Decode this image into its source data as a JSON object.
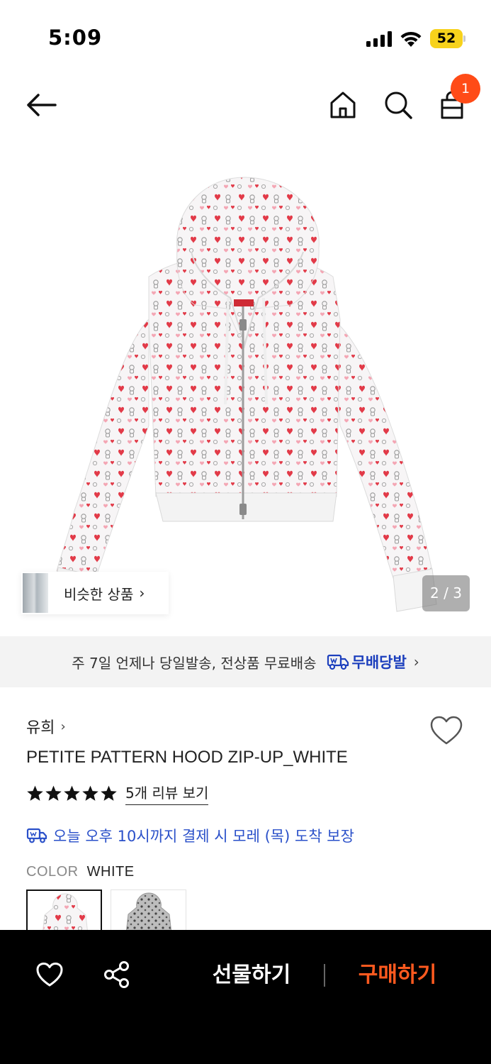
{
  "status_bar": {
    "time": "5:09",
    "battery": "52",
    "battery_color": "#f7d21c",
    "icons": [
      "signal-icon",
      "wifi-icon",
      "battery-icon"
    ]
  },
  "nav": {
    "icons": [
      "back-arrow-icon",
      "home-icon",
      "search-icon",
      "shopping-bag-icon"
    ],
    "cart_count": "1",
    "badge_color": "#ff4b17"
  },
  "gallery": {
    "similar_label": "비슷한 상품",
    "similar_chevron": "›",
    "counter": "2 / 3"
  },
  "shipping_banner": {
    "text": "주 7일 언제나 당일발송, 전상품 무료배송",
    "brand": "무배당발",
    "chevron": "›",
    "brand_color": "#1c3fbd"
  },
  "product": {
    "brand": "유희",
    "brand_chevron": "›",
    "title": "PETITE PATTERN HOOD ZIP-UP_WHITE",
    "rating_stars": 5,
    "review_link": "5개 리뷰 보기",
    "delivery_text": "오늘 오후 10시까지 결제 시 모레 (목) 도착 보장",
    "delivery_color": "#2a50c9",
    "color_label": "COLOR",
    "color_value": "WHITE",
    "color_options": [
      "white",
      "gray"
    ]
  },
  "bottom_bar": {
    "gift_label": "선물하기",
    "buy_label": "구매하기",
    "buy_color": "#ff5a1f"
  }
}
